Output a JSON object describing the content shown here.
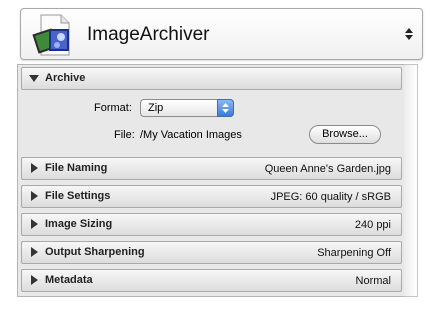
{
  "header": {
    "title": "ImageArchiver",
    "icon": "app-icon"
  },
  "archive": {
    "label": "Archive",
    "expanded": true,
    "format_label": "Format:",
    "format_value": "Zip",
    "file_label": "File:",
    "file_path": "/My Vacation Images",
    "browse_label": "Browse..."
  },
  "sections": [
    {
      "label": "File Naming",
      "value": "Queen Anne's Garden.jpg"
    },
    {
      "label": "File Settings",
      "value": "JPEG: 60 quality / sRGB"
    },
    {
      "label": "Image Sizing",
      "value": "240 ppi"
    },
    {
      "label": "Output Sharpening",
      "value": "Sharpening Off"
    },
    {
      "label": "Metadata",
      "value": "Normal"
    }
  ],
  "colors": {
    "accent": "#3b7bdc",
    "panel_bg": "#e8e8e8"
  }
}
